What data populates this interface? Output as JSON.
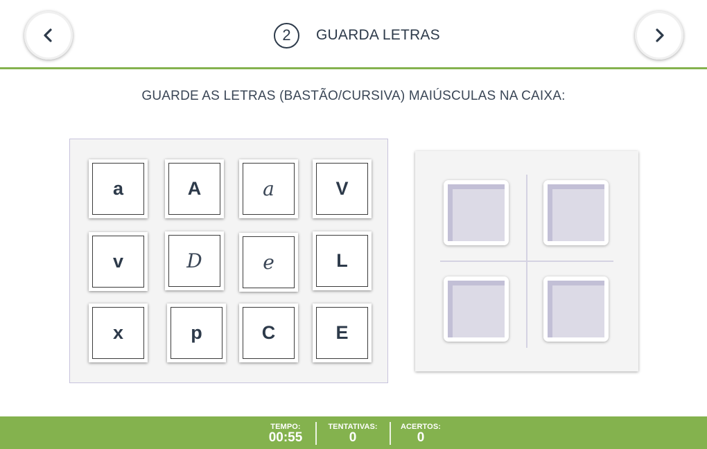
{
  "header": {
    "step_number": "2",
    "title": "GUARDA LETRAS",
    "prev_icon": "chevron-left-icon",
    "next_icon": "chevron-right-icon"
  },
  "instruction": "GUARDE AS LETRAS (BASTÃO/CURSIVA) MAIÚSCULAS NA CAIXA:",
  "tiles": [
    {
      "letter": "a",
      "style": "bastão"
    },
    {
      "letter": "A",
      "style": "bastão"
    },
    {
      "letter": "a",
      "style": "cursiva"
    },
    {
      "letter": "V",
      "style": "bastão"
    },
    {
      "letter": "v",
      "style": "bastão"
    },
    {
      "letter": "D",
      "style": "cursiva"
    },
    {
      "letter": "e",
      "style": "cursiva"
    },
    {
      "letter": "L",
      "style": "bastão"
    },
    {
      "letter": "x",
      "style": "bastão"
    },
    {
      "letter": "p",
      "style": "bastão"
    },
    {
      "letter": "C",
      "style": "bastão"
    },
    {
      "letter": "E",
      "style": "bastão"
    }
  ],
  "drop_slots_count": 4,
  "footer": {
    "tempo_label": "TEMPO:",
    "tempo_value": "00:55",
    "tentativas_label": "TENTATIVAS:",
    "tentativas_value": "0",
    "acertos_label": "ACERTOS:",
    "acertos_value": "0"
  },
  "colors": {
    "accent_green": "#84b24e",
    "text_dark": "#2d3a4a",
    "slot_fill": "#dcdae6",
    "panel_bg": "#f4f4f4"
  }
}
